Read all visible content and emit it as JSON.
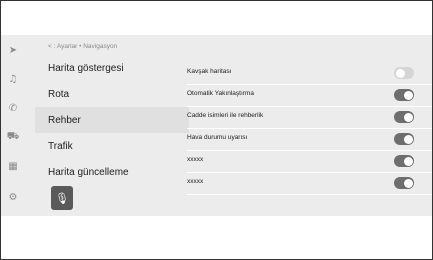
{
  "breadcrumb": "< : Ayarlar  •  Navigasyon",
  "rail_icons": [
    {
      "name": "navigation-arrow-icon",
      "glyph": "➤"
    },
    {
      "name": "music-note-icon",
      "glyph": "♫"
    },
    {
      "name": "phone-icon",
      "glyph": "✆"
    },
    {
      "name": "car-icon",
      "glyph": "⛟"
    },
    {
      "name": "apps-grid-icon",
      "glyph": "▦"
    },
    {
      "name": "settings-gear-icon",
      "glyph": "⚙"
    }
  ],
  "menu": [
    {
      "label": "Harita göstergesi",
      "selected": false
    },
    {
      "label": "Rota",
      "selected": false
    },
    {
      "label": "Rehber",
      "selected": true
    },
    {
      "label": "Trafik",
      "selected": false
    },
    {
      "label": "Harita güncelleme",
      "selected": false
    }
  ],
  "settings": [
    {
      "label": "Kavşak haritası",
      "on": false
    },
    {
      "label": "Otomatik Yakınlaştırma",
      "on": true
    },
    {
      "label": "Cadde isimleri ile rehberlik",
      "on": true
    },
    {
      "label": "Hava durumu uyarısı",
      "on": true
    },
    {
      "label": "xxxxx",
      "on": true
    },
    {
      "label": "xxxxx",
      "on": true
    }
  ],
  "mic_icon": "microphone-icon",
  "colors": {
    "toggle_on": "#6e6e6e",
    "toggle_off": "#d5d5d5",
    "selected_row": "#e0e0e0"
  }
}
